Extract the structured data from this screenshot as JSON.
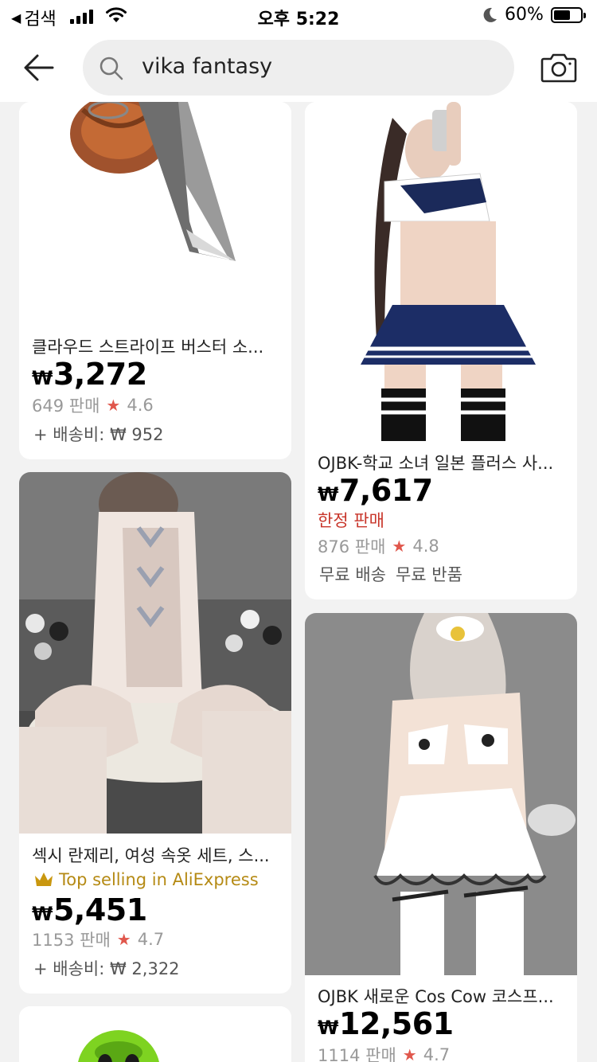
{
  "status_bar": {
    "back_app": "검색",
    "time": "오후 5:22",
    "battery": "60%"
  },
  "header": {
    "search_value": "vika fantasy"
  },
  "products": [
    {
      "title": "클라우드 스트라이프 버스터 소...",
      "currency": "₩",
      "price": "3,272",
      "sold": "649 판매",
      "rating": "4.6",
      "shipping": "+ 배송비: ₩ 952"
    },
    {
      "title": "OJBK-학교 소녀 일본 플러스 사...",
      "currency": "₩",
      "price": "7,617",
      "limited": "한정 판매",
      "sold": "876 판매",
      "rating": "4.8",
      "free_shipping": "무료 배송",
      "free_return": "무료 반품"
    },
    {
      "title": "섹시 란제리, 여성 속옷 세트, 스...",
      "badge": "Top selling in AliExpress",
      "currency": "₩",
      "price": "5,451",
      "sold": "1153 판매",
      "rating": "4.7",
      "shipping": "+ 배송비: ₩ 2,322"
    },
    {
      "title": "OJBK 새로운 Cos Cow 코스프...",
      "currency": "₩",
      "price": "12,561",
      "sold": "1114 판매",
      "rating": "4.7"
    },
    {}
  ],
  "icons": {
    "back": "arrow-left-icon",
    "search": "search-icon",
    "camera": "camera-icon",
    "star": "star-icon",
    "crown": "crown-icon"
  },
  "colors": {
    "price": "#000000",
    "star": "#e0574c",
    "limited": "#c8352a",
    "top_selling": "#b58a14",
    "background": "#f2f2f2"
  }
}
